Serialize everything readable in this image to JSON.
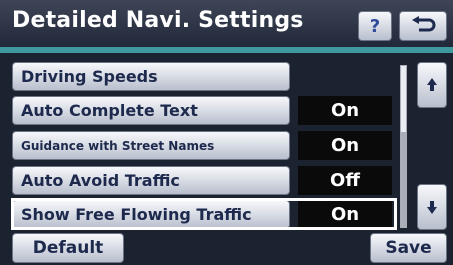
{
  "header": {
    "title": "Detailed Navi. Settings",
    "help_label": "?"
  },
  "settings": [
    {
      "label": "Driving Speeds",
      "value": null
    },
    {
      "label": "Auto Complete Text",
      "value": "On"
    },
    {
      "label": "Guidance with Street Names",
      "value": "On"
    },
    {
      "label": "Auto Avoid Traffic",
      "value": "Off"
    },
    {
      "label": "Show Free Flowing Traffic",
      "value": "On"
    }
  ],
  "footer": {
    "default_label": "Default",
    "save_label": "Save"
  },
  "icons": {
    "back": "back-arrow-icon",
    "scroll_up": "scroll-up-icon",
    "scroll_down": "scroll-down-icon"
  }
}
